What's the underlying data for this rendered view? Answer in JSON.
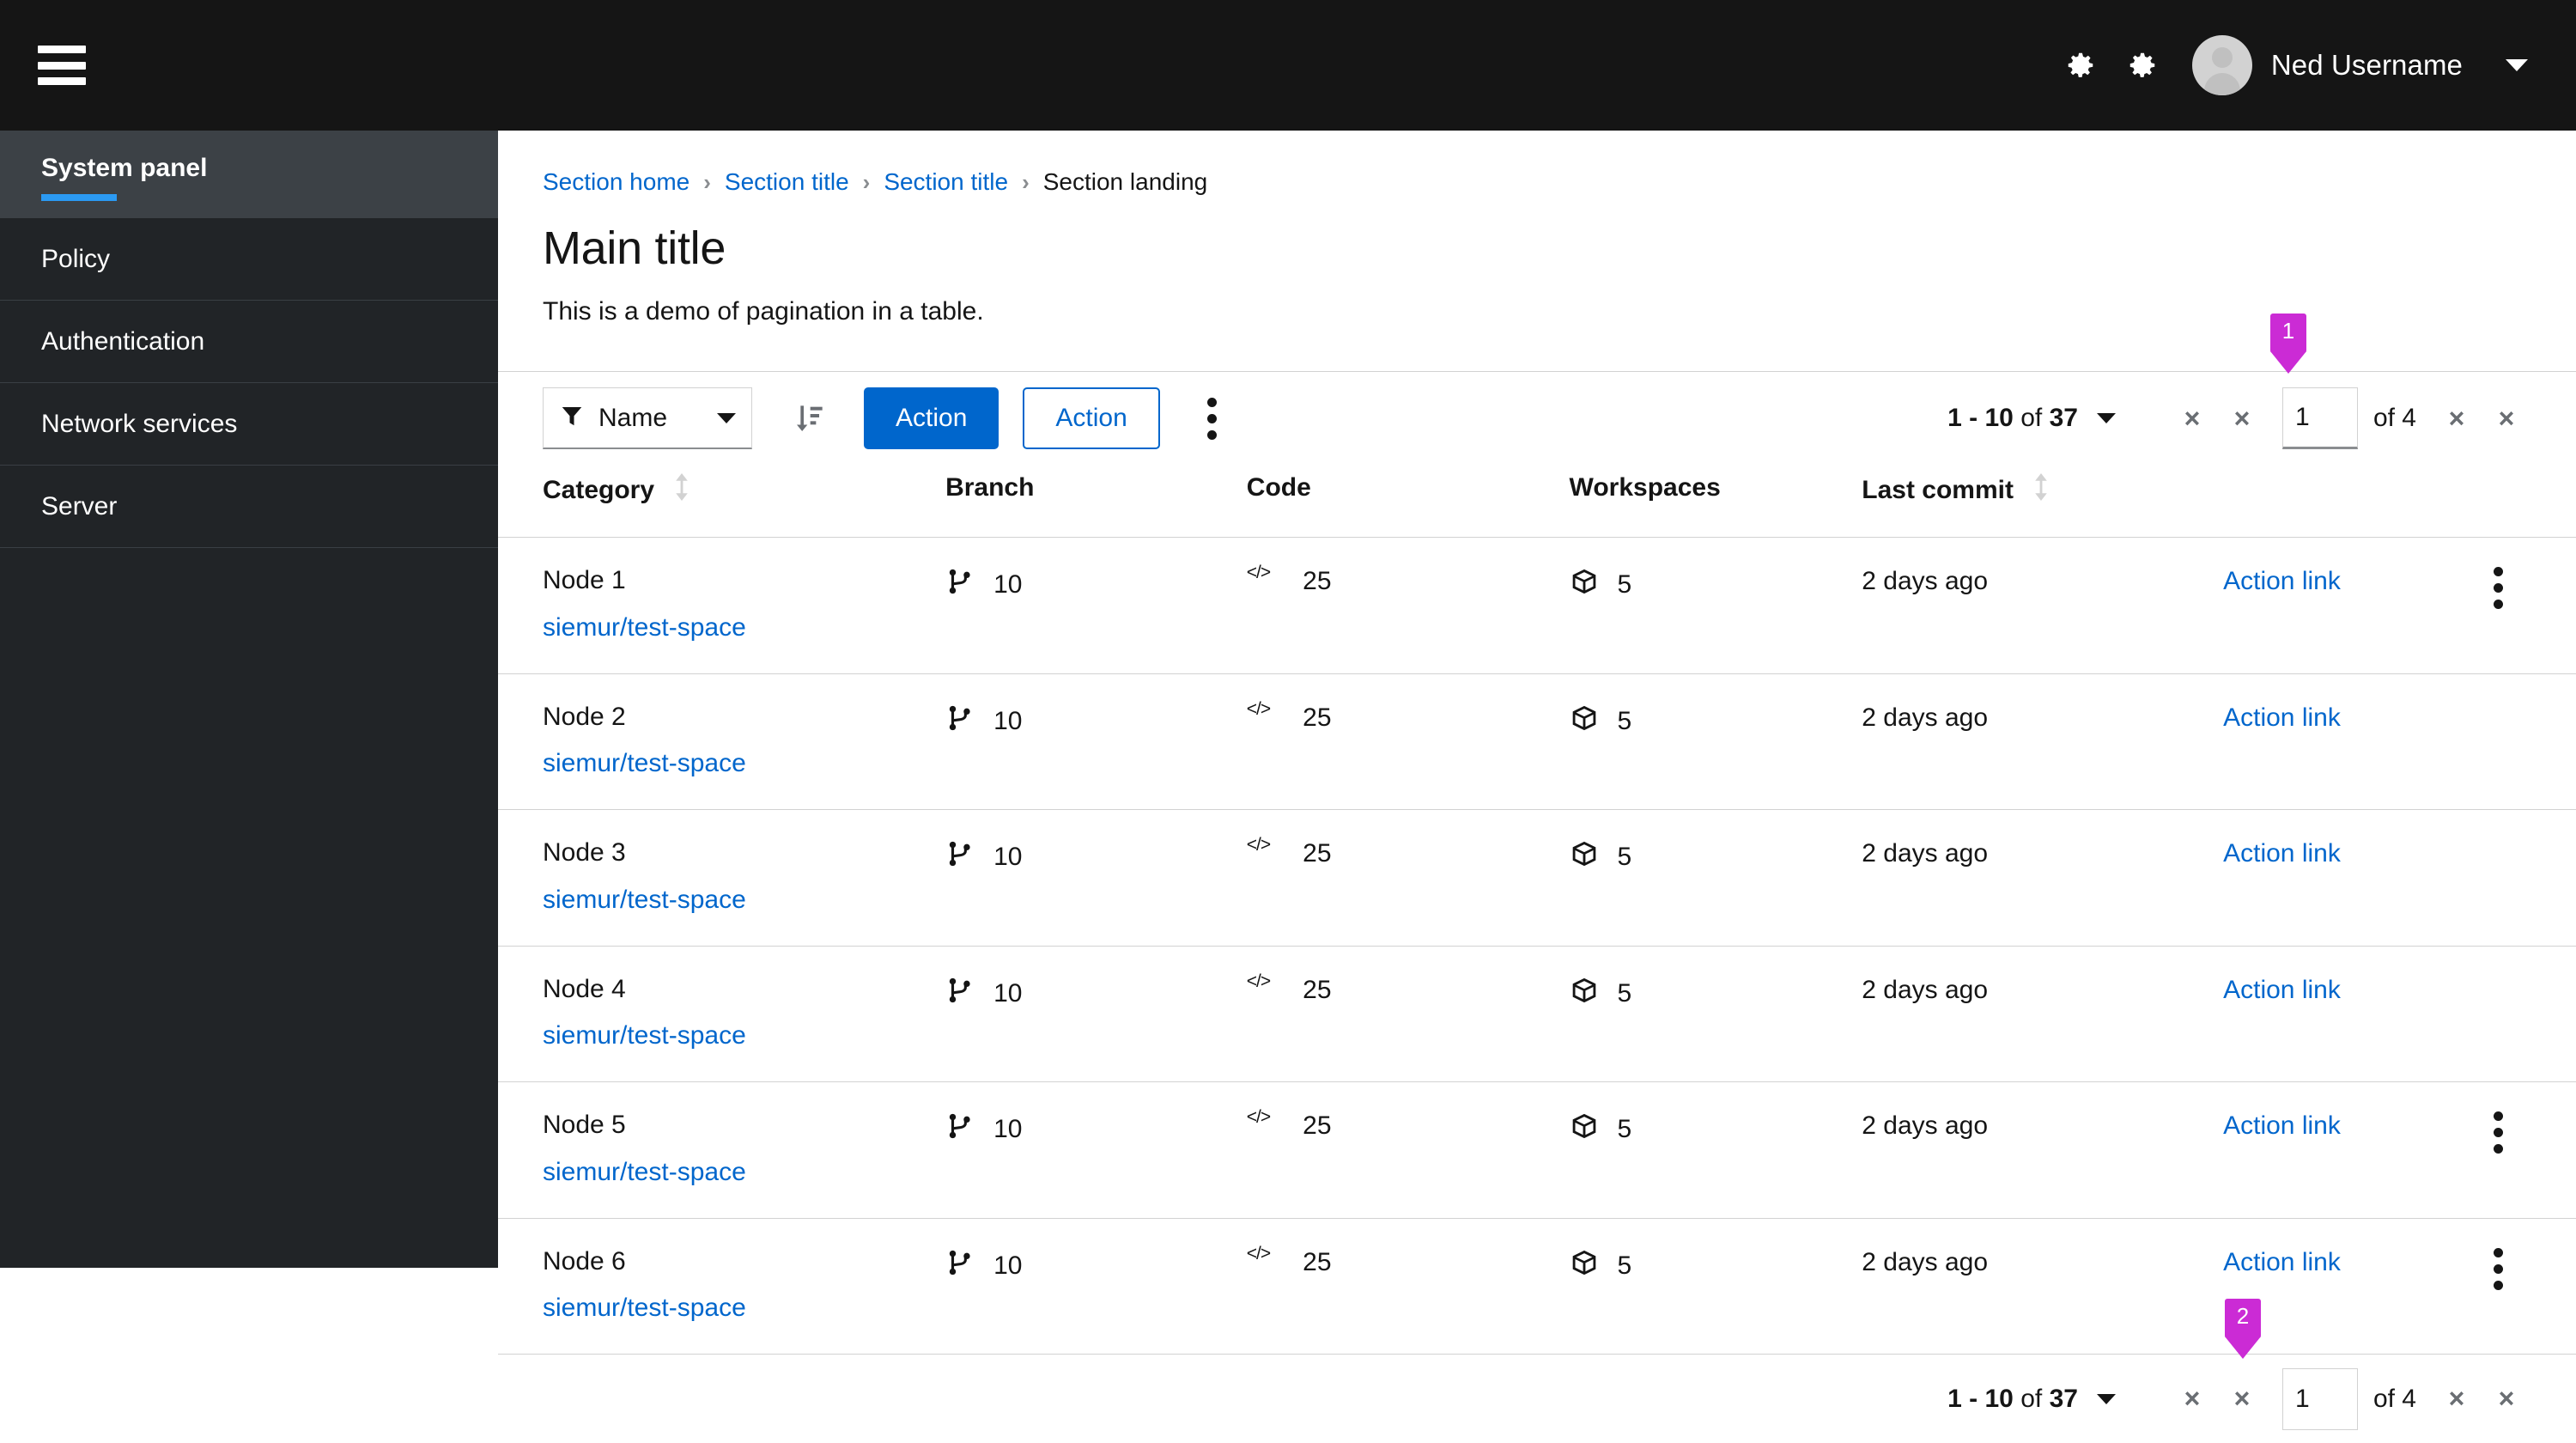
{
  "masthead": {
    "menu_icon": "hamburger-icon",
    "settings_icon_1": "gear-icon",
    "settings_icon_2": "gear-icon",
    "avatar_icon": "user-avatar-icon",
    "username": "Ned Username",
    "caret_icon": "caret-down-icon"
  },
  "sidebar": {
    "items": [
      {
        "label": "System panel",
        "active": true
      },
      {
        "label": "Policy",
        "active": false
      },
      {
        "label": "Authentication",
        "active": false
      },
      {
        "label": "Network services",
        "active": false
      },
      {
        "label": "Server",
        "active": false
      }
    ],
    "active_accent": "#2b9af3"
  },
  "breadcrumb": {
    "items": [
      {
        "label": "Section home",
        "link": true
      },
      {
        "label": "Section title",
        "link": true
      },
      {
        "label": "Section title",
        "link": true
      },
      {
        "label": "Section landing",
        "link": false
      }
    ],
    "separator": "›"
  },
  "page": {
    "title": "Main title",
    "description": "This is a demo of pagination in a table."
  },
  "toolbar": {
    "filter_icon": "filter-icon",
    "filter_label": "Name",
    "filter_caret_icon": "caret-down-icon",
    "sort_icon": "sort-amount-down-icon",
    "primary_action_label": "Action",
    "secondary_action_label": "Action",
    "overflow_icon": "kebab-menu-icon"
  },
  "pagination": {
    "summary_range": "1 - 10",
    "summary_of": "of",
    "summary_total": "37",
    "per_page_caret_icon": "caret-down-icon",
    "first_page_label": "×",
    "prev_page_label": "×",
    "page_value": "1",
    "page_of_label": "of 4",
    "next_page_label": "×",
    "last_page_label": "×"
  },
  "markers": [
    {
      "id": "1",
      "target": "top-page-input"
    },
    {
      "id": "2",
      "target": "bottom-prev-page-button"
    }
  ],
  "marker_color": "#cb2bd5",
  "table": {
    "columns": [
      {
        "label": "Category",
        "sortable": true
      },
      {
        "label": "Branch",
        "sortable": false
      },
      {
        "label": "Code",
        "sortable": false
      },
      {
        "label": "Workspaces",
        "sortable": false
      },
      {
        "label": "Last commit",
        "sortable": true
      },
      {
        "label": "",
        "sortable": false
      },
      {
        "label": "",
        "sortable": false
      }
    ],
    "rows": [
      {
        "category": "Node 1",
        "repo": "siemur/test-space",
        "branch": "10",
        "code": "25",
        "workspaces": "5",
        "last_commit": "2 days ago",
        "action": "Action link",
        "kebab": true
      },
      {
        "category": "Node 2",
        "repo": "siemur/test-space",
        "branch": "10",
        "code": "25",
        "workspaces": "5",
        "last_commit": "2 days ago",
        "action": "Action link",
        "kebab": false
      },
      {
        "category": "Node 3",
        "repo": "siemur/test-space",
        "branch": "10",
        "code": "25",
        "workspaces": "5",
        "last_commit": "2 days ago",
        "action": "Action link",
        "kebab": false
      },
      {
        "category": "Node 4",
        "repo": "siemur/test-space",
        "branch": "10",
        "code": "25",
        "workspaces": "5",
        "last_commit": "2 days ago",
        "action": "Action link",
        "kebab": false
      },
      {
        "category": "Node 5",
        "repo": "siemur/test-space",
        "branch": "10",
        "code": "25",
        "workspaces": "5",
        "last_commit": "2 days ago",
        "action": "Action link",
        "kebab": true
      },
      {
        "category": "Node 6",
        "repo": "siemur/test-space",
        "branch": "10",
        "code": "25",
        "workspaces": "5",
        "last_commit": "2 days ago",
        "action": "Action link",
        "kebab": true
      }
    ],
    "branch_icon": "code-branch-icon",
    "code_icon": "code-icon",
    "workspace_icon": "cube-icon",
    "sort_icon": "sort-updown-icon",
    "row_overflow_icon": "kebab-menu-icon"
  },
  "colors": {
    "link": "#0066cc",
    "primary_button": "#0066cc",
    "masthead_bg": "#151515",
    "sidebar_bg": "#212427",
    "sidebar_active_bg": "#3c4146"
  }
}
